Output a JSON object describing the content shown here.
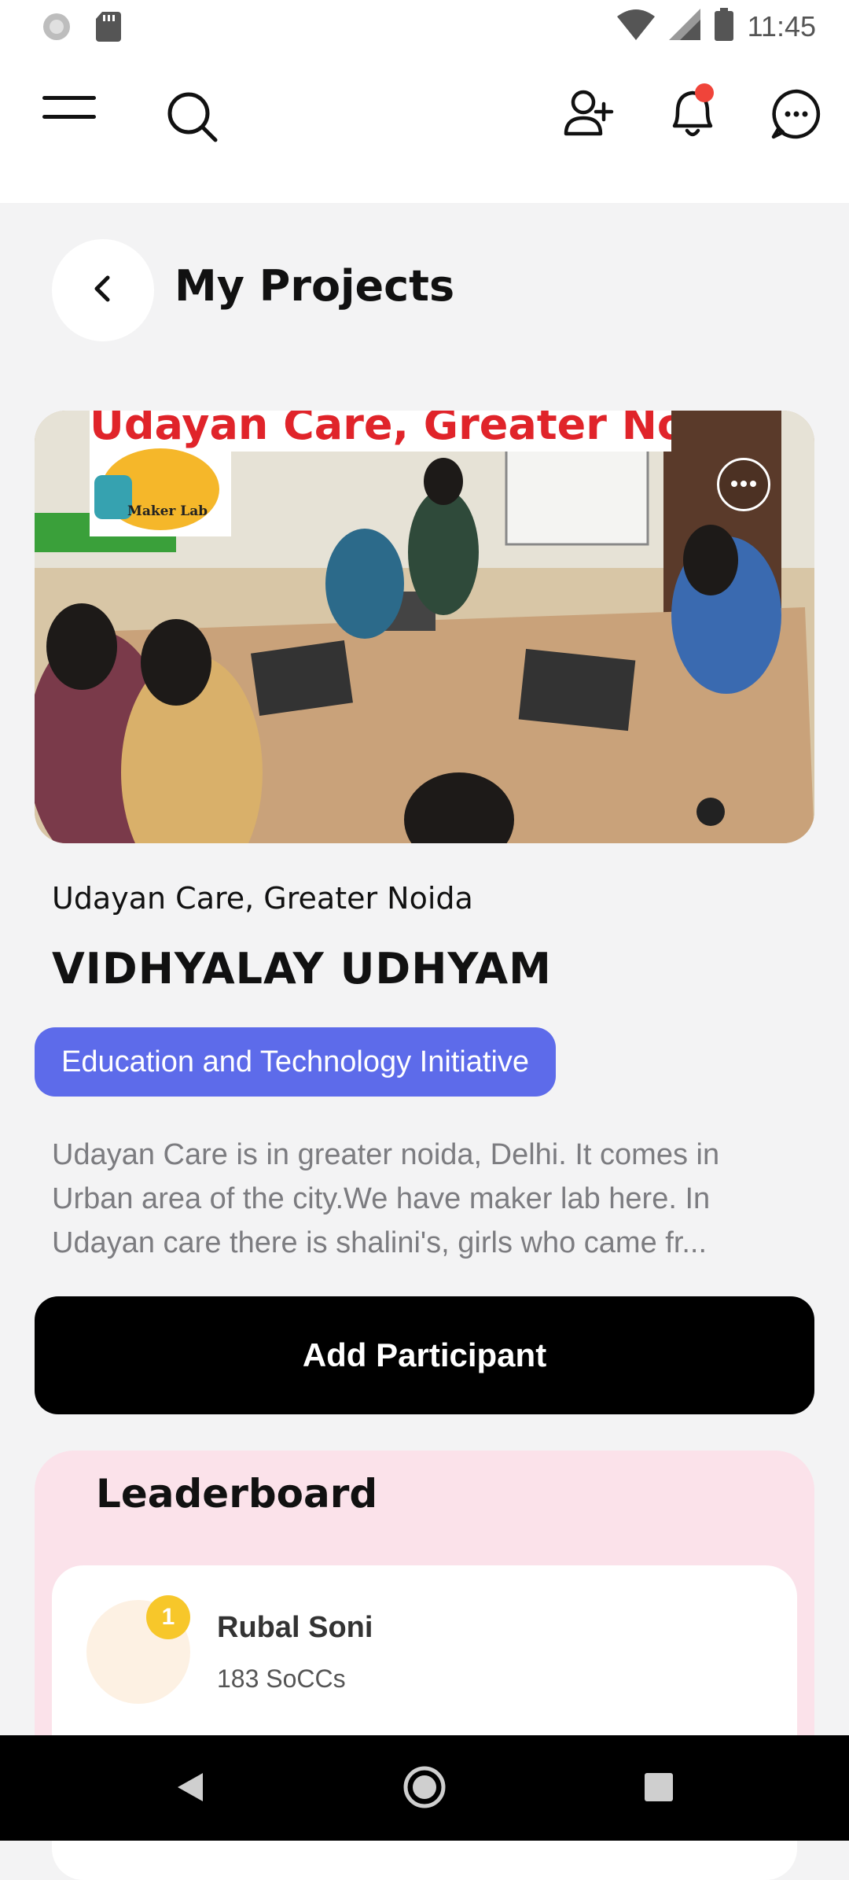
{
  "status_bar": {
    "time": "11:45",
    "icons": [
      "settings-circle-icon",
      "sd-card-icon",
      "wifi-icon",
      "signal-icon",
      "battery-icon"
    ]
  },
  "app_bar": {
    "icons": [
      "menu-icon",
      "search-icon",
      "add-user-icon",
      "bell-icon",
      "chat-icon"
    ],
    "notification_dot_color": "#f0443a"
  },
  "page": {
    "title": "My Projects"
  },
  "project": {
    "image_banner_text": "Udayan Care, Greater Noida",
    "image_logo_text": "Maker Lab",
    "location": "Udayan Care, Greater Noida",
    "name": "VIDHYALAY UDHYAM",
    "tag": "Education and Technology Initiative",
    "description_lines": [
      "Udayan Care is in greater noida, Delhi. It comes in",
      "Urban area of the city.We have maker lab here.  In",
      "Udayan care  there is shalini's, girls who came fr..."
    ],
    "add_button_label": "Add Participant"
  },
  "leaderboard": {
    "title": "Leaderboard",
    "entries": [
      {
        "rank": "1",
        "name": "Rubal Soni",
        "score": "183 SoCCs"
      }
    ]
  },
  "colors": {
    "accent": "#5d6bea",
    "leaderboard_bg": "#fbe2ea",
    "rank_badge": "#f7c72a"
  }
}
